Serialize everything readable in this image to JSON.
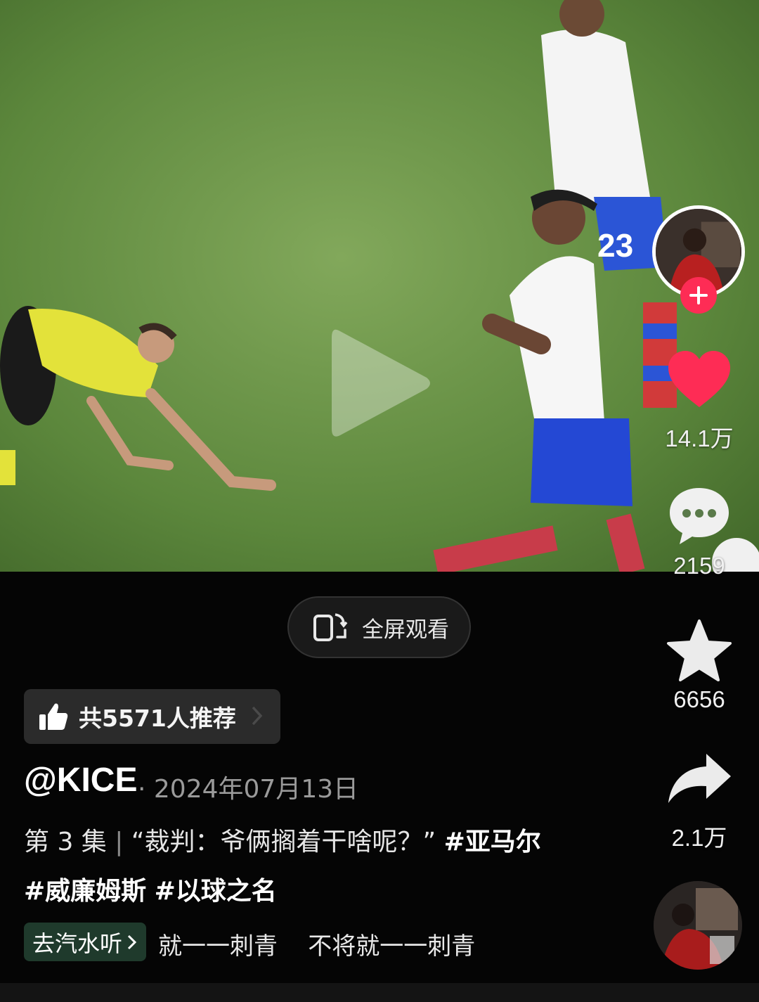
{
  "video": {
    "play_icon": "play-icon"
  },
  "rail": {
    "follow_icon": "plus-icon",
    "like": {
      "icon": "heart-icon",
      "count": "14.1万",
      "color": "#fe2c55"
    },
    "comment": {
      "icon": "comment-icon",
      "count": "2159"
    },
    "favorite": {
      "icon": "star-icon",
      "count": "6656"
    },
    "share": {
      "icon": "share-icon",
      "count": "2.1万"
    }
  },
  "fullscreen": {
    "icon": "rotate-screen-icon",
    "label": "全屏观看"
  },
  "recommend": {
    "icon": "thumbs-up-icon",
    "label": "共5571人推荐"
  },
  "post": {
    "author": "@KICE",
    "date": "· 2024年07月13日",
    "episode": "第 3 集",
    "separator": "|",
    "text": "“裁判：爷俩搁着干啥呢？”",
    "tags": [
      "#亚马尔",
      "#威廉姆斯",
      "#以球之名"
    ]
  },
  "music": {
    "chip_label": "去汽水听",
    "chip_color": "#1f3a2c",
    "text": "就一一刺青    不将就一一刺青"
  }
}
